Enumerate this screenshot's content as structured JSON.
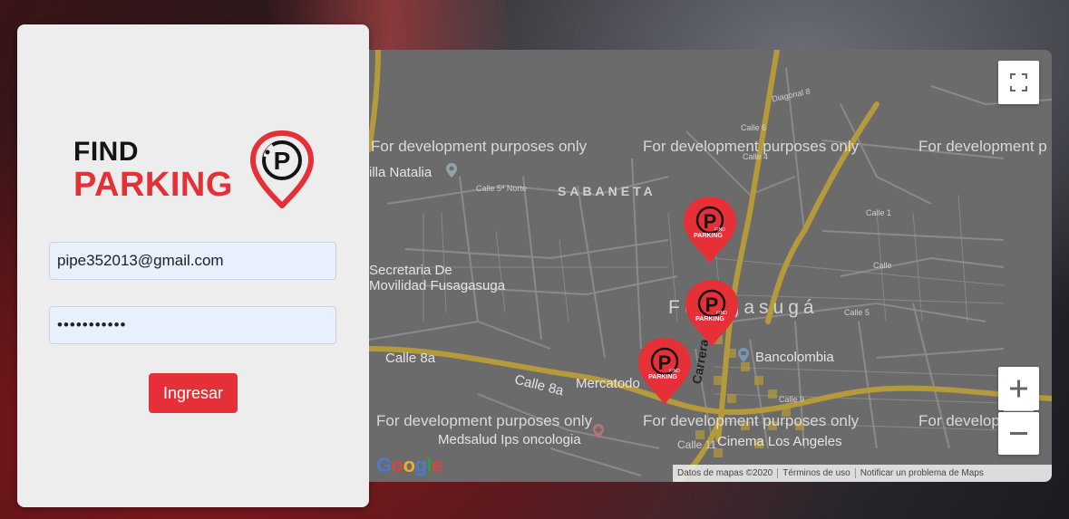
{
  "login": {
    "logo_find": "FIND",
    "logo_parking": "PARKING",
    "logo_pin_letter": "P",
    "email_value": "pipe352013@gmail.com",
    "password_value": "•••••••••••",
    "submit_label": "Ingresar"
  },
  "map": {
    "watermarks": [
      "For development purposes only",
      "For development purposes only",
      "For development p",
      "For development purposes only",
      "For development purposes only",
      "For develop"
    ],
    "places": {
      "villa_natalia": "illa Natalia",
      "calle_5_norte": "Calle 5ª Norte",
      "sabaneta": "SABANETA",
      "secretaria_line1": "Secretaria De",
      "secretaria_line2": "Movilidad Fusagasuga",
      "fusagasuga": "Fusagasugá",
      "calle_8a": "Calle 8a",
      "calle_8a_b": "Calle 8a",
      "carrera_8": "Carrera 8",
      "mercatodo": "Mercatodo",
      "bancolombia": "Bancolombia",
      "medsalud": "Medsalud Ips oncologia",
      "calle_11": "Calle 11",
      "cinema": "Cinema Los Angeles",
      "diagonal_8": "Diagonal 8",
      "calle_6": "Calle 6",
      "calle_4": "Calle 4",
      "calle_1": "Calle 1",
      "calle": "Calle",
      "calle_5": "Calle 5",
      "calle_9": "Calle 9"
    },
    "marker_label_top": "FIND",
    "marker_label_bottom": "PARKING",
    "marker_letter": "P",
    "footer": {
      "map_data": "Datos de mapas ©2020",
      "terms": "Términos de uso",
      "report": "Notificar un problema de Maps"
    },
    "google_letters": [
      "G",
      "o",
      "o",
      "g",
      "l",
      "e"
    ],
    "colors": {
      "brand_red": "#e53038",
      "road_major": "#b59a3c",
      "road_minor": "#8a8a8a",
      "land": "#6b6b6b"
    },
    "icons": {
      "fullscreen": "fullscreen-icon",
      "zoom_in": "plus-icon",
      "zoom_out": "minus-icon",
      "place": "place-pin-icon"
    }
  }
}
